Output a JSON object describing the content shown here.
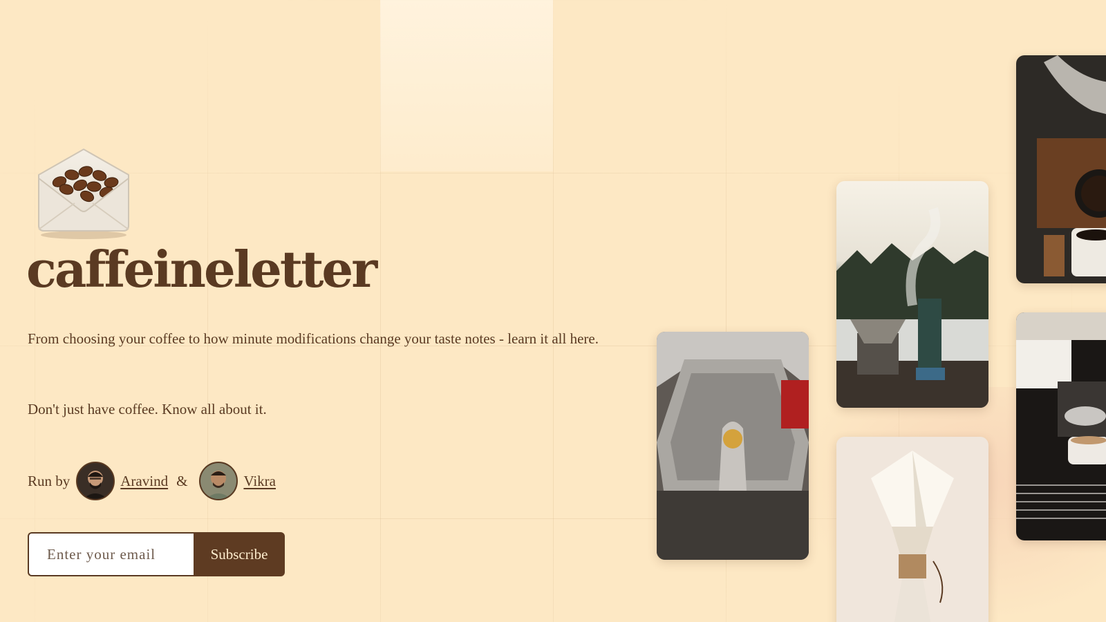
{
  "brand": {
    "logo_icon": "envelope-coffee-beans-icon",
    "name": "caffeineletter"
  },
  "hero": {
    "description": "From choosing your coffee to how minute modifications change your taste notes - learn it all here.",
    "tagline": "Don't just have coffee. Know all about it."
  },
  "authors": {
    "prefix": "Run by",
    "separator": "&",
    "people": [
      {
        "name": "Aravind"
      },
      {
        "name": "Vikra"
      }
    ]
  },
  "subscribe": {
    "placeholder": "Enter your email",
    "button_label": "Subscribe"
  },
  "gallery": [
    {
      "subject": "pour-over-kettle-photo"
    },
    {
      "subject": "camping-stove-coffee-photo"
    },
    {
      "subject": "moka-pot-photo"
    },
    {
      "subject": "chemex-filter-photo"
    },
    {
      "subject": "espresso-machine-photo"
    }
  ],
  "colors": {
    "background": "#fde8c4",
    "text": "#5a3a22",
    "button": "#5e3b22"
  }
}
